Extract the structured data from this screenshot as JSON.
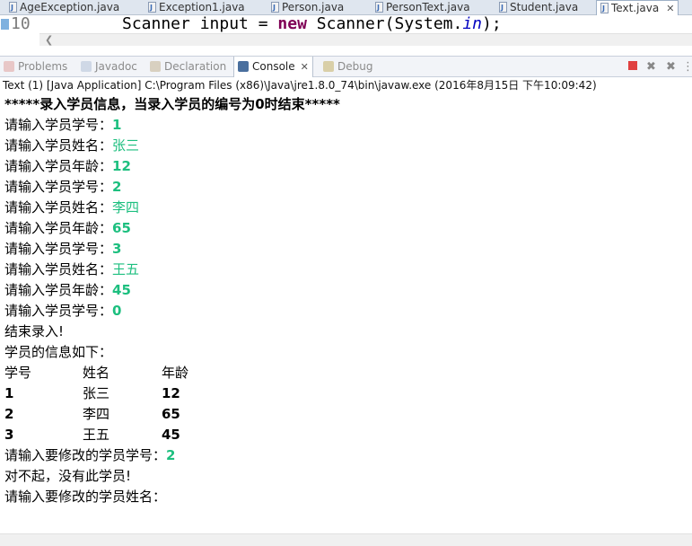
{
  "editor_tabs": [
    {
      "label": "AgeException.java",
      "active": false
    },
    {
      "label": "Exception1.java",
      "active": false
    },
    {
      "label": "Person.java",
      "active": false
    },
    {
      "label": "PersonText.java",
      "active": false
    },
    {
      "label": "Student.java",
      "active": false
    },
    {
      "label": "Text.java",
      "active": true,
      "close": "✕"
    }
  ],
  "editor": {
    "line_number": "10",
    "code": {
      "type": "Scanner",
      "var": "input",
      "eq": "=",
      "new_kw": "new",
      "ctor": "Scanner(System.",
      "field": "in",
      "end": ");"
    }
  },
  "view_tabs": [
    {
      "label": "Problems",
      "icon": "problems-icon"
    },
    {
      "label": "Javadoc",
      "icon": "javadoc-icon"
    },
    {
      "label": "Declaration",
      "icon": "declaration-icon"
    },
    {
      "label": "Console",
      "icon": "console-icon",
      "active": true,
      "close": "✕"
    },
    {
      "label": "Debug",
      "icon": "debug-icon"
    }
  ],
  "process_info": "Text (1) [Java Application] C:\\Program Files (x86)\\Java\\jre1.8.0_74\\bin\\javaw.exe (2016年8月15日 下午10:09:42)",
  "colors": {
    "input_text": "#1dbf7f",
    "terminate_button": "#e04040"
  },
  "console": {
    "header": "*****录入学员信息，当录入学员的编号为0时结束*****",
    "prompts": [
      {
        "prompt": "请输入学员学号：",
        "input": "1"
      },
      {
        "prompt": "请输入学员姓名：",
        "input": "张三"
      },
      {
        "prompt": "请输入学员年龄：",
        "input": "12"
      },
      {
        "prompt": "请输入学员学号：",
        "input": "2"
      },
      {
        "prompt": "请输入学员姓名：",
        "input": "李四"
      },
      {
        "prompt": "请输入学员年龄：",
        "input": "65"
      },
      {
        "prompt": "请输入学员学号：",
        "input": "3"
      },
      {
        "prompt": "请输入学员姓名：",
        "input": "王五"
      },
      {
        "prompt": "请输入学员年龄：",
        "input": "45"
      },
      {
        "prompt": "请输入学员学号：",
        "input": "0"
      }
    ],
    "end_msg": "结束录入!",
    "info_title": "学员的信息如下：",
    "table": {
      "headers": [
        "学号",
        "姓名",
        "年龄"
      ],
      "rows": [
        [
          "1",
          "张三",
          "12"
        ],
        [
          "2",
          "李四",
          "65"
        ],
        [
          "3",
          "王五",
          "45"
        ]
      ]
    },
    "modify_prompt": "请输入要修改的学员学号：",
    "modify_input": "2",
    "sorry_msg": "对不起，没有此学员!",
    "name_prompt": "请输入要修改的学员姓名："
  }
}
